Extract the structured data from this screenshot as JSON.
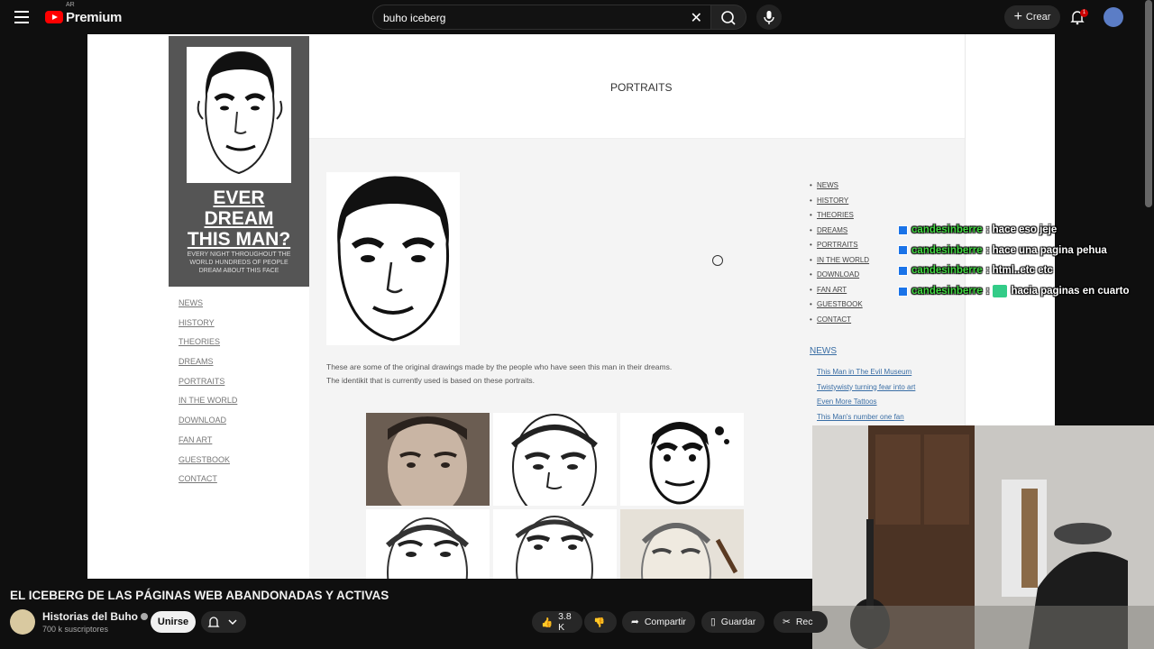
{
  "youtube": {
    "logo_text": "Premium",
    "region": "AR",
    "search_value": "buho iceberg",
    "create_label": "Crear",
    "notification_count": "1"
  },
  "website": {
    "header_title_lines": [
      "EVER",
      "DREAM",
      "THIS MAN?"
    ],
    "header_subtitle": "EVERY NIGHT THROUGHOUT THE WORLD HUNDREDS OF PEOPLE DREAM ABOUT THIS FACE",
    "left_nav": [
      "NEWS",
      "HISTORY",
      "THEORIES",
      "DREAMS",
      "PORTRAITS",
      "IN THE WORLD",
      "DOWNLOAD",
      "FAN ART",
      "GUESTBOOK",
      "CONTACT"
    ],
    "page_title": "PORTRAITS",
    "caption_1": "These are some of the original drawings made by the people who have seen this man in their dreams.",
    "caption_2": "The identikit that is currently used is based on these portraits.",
    "right_nav": [
      "NEWS",
      "HISTORY",
      "THEORIES",
      "DREAMS",
      "PORTRAITS",
      "IN THE WORLD",
      "DOWNLOAD",
      "FAN ART",
      "GUESTBOOK",
      "CONTACT"
    ],
    "news_heading": "NEWS",
    "news_items": [
      "This Man in The Evil Museum",
      "Twistywisty turning fear into art",
      "Even More Tattoos",
      "This Man's number one fan"
    ]
  },
  "chat": [
    {
      "user": "candesinberre",
      "text": ": hace eso jeje",
      "emote": false
    },
    {
      "user": "candesinberre",
      "text": ": hace una pagina pehua",
      "emote": false
    },
    {
      "user": "candesinberre",
      "text": ": html..etc etc",
      "emote": false
    },
    {
      "user": "candesinberre",
      "text": "hacia paginas en cuarto",
      "emote": true
    }
  ],
  "video": {
    "title": "EL ICEBERG DE LAS PÁGINAS WEB ABANDONADAS Y ACTIVAS",
    "channel": "Historias del Buho",
    "subscribers": "700 k suscriptores",
    "join_label": "Unirse",
    "likes": "3.8 K",
    "share_label": "Compartir",
    "save_label": "Guardar",
    "clip_label": "Rec"
  }
}
